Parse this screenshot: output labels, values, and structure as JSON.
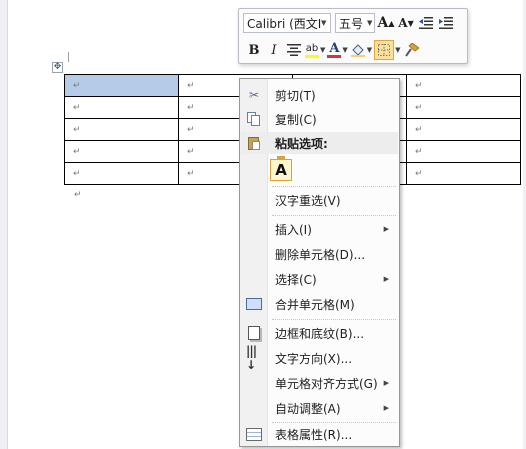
{
  "colors": {
    "selection": "#b5cbe8",
    "menu_bg": "#fcfcfc",
    "menu_gutter": "#f1f1f1",
    "highlight_yellow": "#ffff00",
    "font_color_red": "#e03030",
    "active_button_bg": "#fbe19a"
  },
  "document": {
    "table_handle_icon": "move-cross-icon",
    "cell_mark": "↵",
    "table": [
      [
        "↵",
        "↵",
        "",
        "↵"
      ],
      [
        "↵",
        "↵",
        "",
        "↵"
      ],
      [
        "↵",
        "↵",
        "",
        "↵"
      ],
      [
        "↵",
        "↵",
        "",
        "↵"
      ],
      [
        "↵",
        "↵",
        "",
        "↵"
      ]
    ],
    "after_table_mark": "↵"
  },
  "mini_toolbar": {
    "font_name": "Calibri (西文I",
    "font_size": "五号",
    "grow_font": "A",
    "shrink_font": "A",
    "bold": "B",
    "italic": "I",
    "highlight_label": "ab",
    "font_color_label": "A",
    "icons": [
      "grow-font-icon",
      "shrink-font-icon",
      "decrease-indent-icon",
      "increase-indent-icon",
      "align-center-icon",
      "highlight-icon",
      "font-color-icon",
      "shading-icon",
      "borders-icon",
      "format-painter-icon"
    ]
  },
  "context_menu": {
    "cut": "剪切(T)",
    "copy": "复制(C)",
    "paste_options": "粘贴选项:",
    "paste_keep_text": "A",
    "reconvert": "汉字重选(V)",
    "insert": "插入(I)",
    "delete_cells": "删除单元格(D)...",
    "select": "选择(C)",
    "merge_cells": "合并单元格(M)",
    "borders_shading": "边框和底纹(B)...",
    "text_direction": "文字方向(X)...",
    "cell_alignment": "单元格对齐方式(G)",
    "autofit": "自动调整(A)",
    "table_properties": "表格属性(R)...",
    "submenu_arrow": "▶"
  }
}
